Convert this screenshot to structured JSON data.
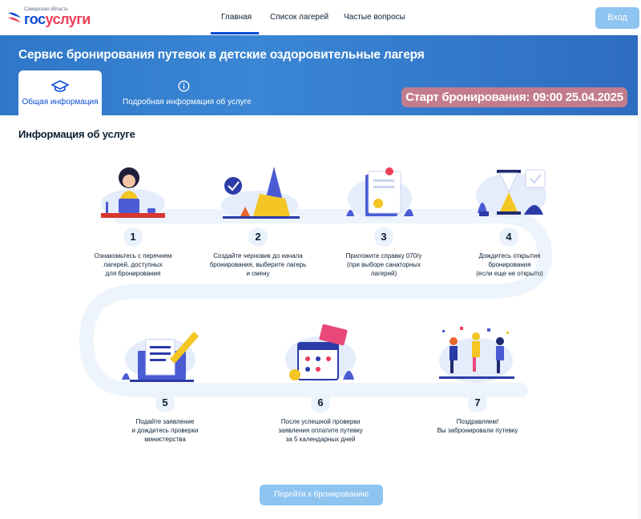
{
  "header": {
    "logo_small": "Самарская область",
    "logo_part1": "гос",
    "logo_part2": "услуги",
    "nav": [
      "Главная",
      "Список лагерей",
      "Частые вопросы"
    ],
    "login_label": "Вход"
  },
  "banner": {
    "title": "Сервис бронирования путевок в детские оздоровительные лагеря",
    "tabs": [
      "Общая информация",
      "Подробная информация об услуге"
    ],
    "start_label": "Старт бронирования: 09:00 25.04.2025"
  },
  "section": {
    "title": "Информация об услуге"
  },
  "steps": [
    {
      "number": "1",
      "text": "Ознакомьтесь с перечнем\nлагерей, доступных\nдля бронирования",
      "icon": "girl-laptop-illustration"
    },
    {
      "number": "2",
      "text": "Создайте черновик до начала\nбронирования, выберите лагерь\nи смену",
      "icon": "camp-tent-illustration"
    },
    {
      "number": "3",
      "text": "Приложите справку 070/у\n(при выборе санаторных\nлагерей)",
      "icon": "certificate-document-illustration"
    },
    {
      "number": "4",
      "text": "Дождитесь открытия\nбронирования\n(если еще не открыто)",
      "icon": "hourglass-calendar-illustration"
    },
    {
      "number": "5",
      "text": "Подайте заявление\nи дождитесь проверки\nминистерства",
      "icon": "monitor-document-illustration"
    },
    {
      "number": "6",
      "text": "После успешной проверки\nзаявления оплатите путевку\nза 5 календарных дней",
      "icon": "calendar-payment-illustration"
    },
    {
      "number": "7",
      "text": "Поздравляем!\nВы забронировали путевку",
      "icon": "celebrating-people-illustration"
    }
  ],
  "actions": {
    "go_booking": "Перейти к бронированию"
  },
  "colors": {
    "accent": "#0d4cd3",
    "banner": "#3a86d4",
    "button": "#8ec4f0",
    "badge": "#c27c8d",
    "illustration": "#4a5bd4"
  }
}
